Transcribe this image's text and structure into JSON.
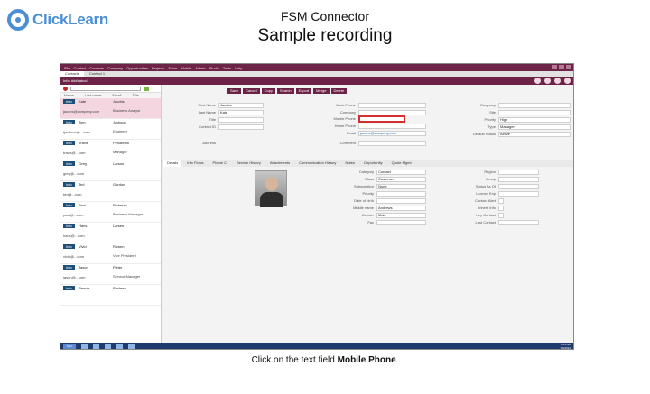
{
  "logo": {
    "text": "ClickLearn"
  },
  "slide": {
    "title": "FSM Connector",
    "subtitle": "Sample recording",
    "caption_pre": "Click on the text field ",
    "caption_bold": "Mobile Phone",
    "caption_post": "."
  },
  "app": {
    "menu": [
      "File",
      "Contact",
      "Contacts",
      "Company",
      "Opportunities",
      "Projects",
      "Sales",
      "Mobile",
      "Admin",
      "Studio",
      "Tools",
      "Help"
    ],
    "tabs": [
      "Contacts",
      "Contact 1"
    ],
    "header": "Info: ####abcd",
    "actions": [
      "Save",
      "Cancel",
      "Copy",
      "Search",
      "Export",
      "Merge",
      "Delete"
    ],
    "list_headers": [
      "Name",
      "Last name",
      "Email",
      "Title"
    ],
    "contacts": [
      {
        "badge": "Info",
        "name": "Kate",
        "last": "Jacobs",
        "email": "jacobs@company.com",
        "title": "Business Analyst"
      },
      {
        "badge": "Info",
        "name": "Tom",
        "last": "Jackson",
        "email": "tjackson@...com",
        "title": "Engineer"
      },
      {
        "badge": "Info",
        "name": "Travis",
        "last": "Pendleton",
        "email": "travis@...com",
        "title": "Manager"
      },
      {
        "badge": "Info",
        "name": "Greg",
        "last": "Larson",
        "email": "greg@...com",
        "title": ""
      },
      {
        "badge": "Info",
        "name": "Ted",
        "last": "Gordon",
        "email": "ted@...com",
        "title": ""
      },
      {
        "badge": "Info",
        "name": "Paul",
        "last": "Richman",
        "email": "paul@...com",
        "title": "Business Manager"
      },
      {
        "badge": "Info",
        "name": "Hans",
        "last": "Larsen",
        "email": "hans@...com",
        "title": ""
      },
      {
        "badge": "Info",
        "name": "Vivid",
        "last": "Rowen",
        "email": "vivid@...com",
        "title": "Vice President"
      },
      {
        "badge": "Info",
        "name": "Jason",
        "last": "Pieter",
        "email": "jason@...com",
        "title": "Service Manager"
      },
      {
        "badge": "Info",
        "name": "Rennis",
        "last": "Reviews",
        "email": "",
        "title": ""
      }
    ],
    "fields_left": [
      {
        "label": "First Name",
        "value": "Jacobs"
      },
      {
        "label": "Last Name",
        "value": "Kate"
      },
      {
        "label": "Title",
        "value": ""
      },
      {
        "label": "Contact ID",
        "value": ""
      },
      {
        "label": "Address",
        "value": ""
      }
    ],
    "fields_mid": [
      {
        "label": "Work Phone",
        "value": ""
      },
      {
        "label": "Company",
        "value": ""
      },
      {
        "label": "Mobile Phone",
        "value": ""
      },
      {
        "label": "Home Phone",
        "value": ""
      },
      {
        "label": "Email",
        "value": "jacobs@company.com"
      },
      {
        "label": "Comment",
        "value": ""
      }
    ],
    "fields_right": [
      {
        "label": "Company",
        "value": ""
      },
      {
        "label": "Site",
        "value": ""
      },
      {
        "label": "Priority",
        "value": "High"
      },
      {
        "label": "Type",
        "value": "Manager"
      },
      {
        "label": "Default Status",
        "value": "Active"
      }
    ],
    "subtabs": [
      "Details",
      "Info Flows",
      "Phone Cl",
      "Service History",
      "Attachments",
      "Communication History",
      "Notes",
      "Opportunity",
      "Quote Mgmt"
    ],
    "fields_lower": [
      {
        "label": "Category",
        "value": "Contact"
      },
      {
        "label": "Class",
        "value": "Customer"
      },
      {
        "label": "Subscription",
        "value": "None"
      },
      {
        "label": "Priority",
        "value": ""
      },
      {
        "label": "Date of birth",
        "value": ""
      },
      {
        "label": "Middle name",
        "value": "Andrews"
      },
      {
        "label": "Gender",
        "value": "Male"
      },
      {
        "label": "Fax",
        "value": ""
      }
    ],
    "fields_lower_right": [
      {
        "label": "Region",
        "value": ""
      },
      {
        "label": "Group",
        "value": ""
      },
      {
        "label": "Status As Of",
        "value": ""
      },
      {
        "label": "License Exp",
        "value": ""
      },
      {
        "label": "Contact Alert",
        "value": ""
      },
      {
        "label": "Inherit Info",
        "value": ""
      },
      {
        "label": "Key Contact",
        "value": ""
      },
      {
        "label": "Last Contact",
        "value": ""
      }
    ],
    "taskbar": {
      "start": "Start",
      "time": "9:04 AM",
      "date": "7/4/2012"
    }
  }
}
